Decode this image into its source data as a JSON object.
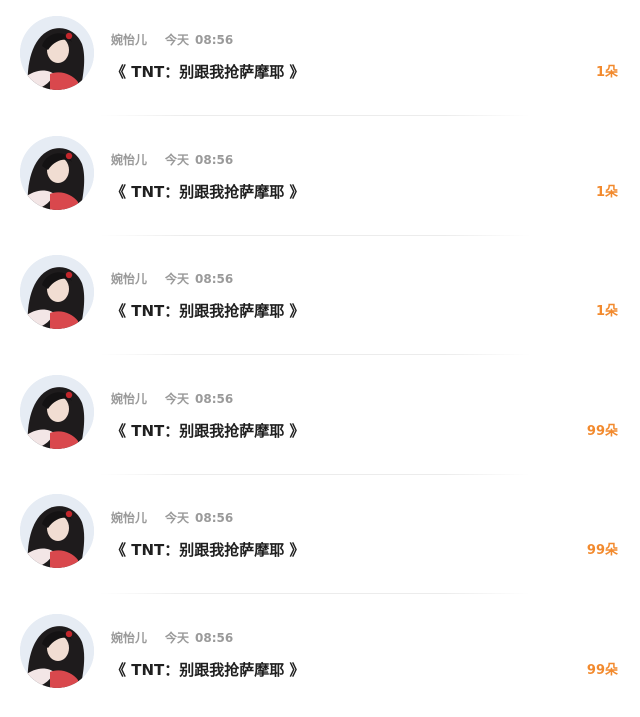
{
  "rows": [
    {
      "username": "婉怡儿",
      "day": "今天",
      "time": "08:56",
      "title": "《 TNT：别跟我抢萨摩耶 》",
      "count": "1朵"
    },
    {
      "username": "婉怡儿",
      "day": "今天",
      "time": "08:56",
      "title": "《 TNT：别跟我抢萨摩耶 》",
      "count": "1朵"
    },
    {
      "username": "婉怡儿",
      "day": "今天",
      "time": "08:56",
      "title": "《 TNT：别跟我抢萨摩耶 》",
      "count": "1朵"
    },
    {
      "username": "婉怡儿",
      "day": "今天",
      "time": "08:56",
      "title": "《 TNT：别跟我抢萨摩耶 》",
      "count": "99朵"
    },
    {
      "username": "婉怡儿",
      "day": "今天",
      "time": "08:56",
      "title": "《 TNT：别跟我抢萨摩耶 》",
      "count": "99朵"
    },
    {
      "username": "婉怡儿",
      "day": "今天",
      "time": "08:56",
      "title": "《 TNT：别跟我抢萨摩耶 》",
      "count": "99朵"
    }
  ],
  "colors": {
    "count": "#f28a2e",
    "meta": "#9a9a9a",
    "title": "#1f1f1f"
  }
}
